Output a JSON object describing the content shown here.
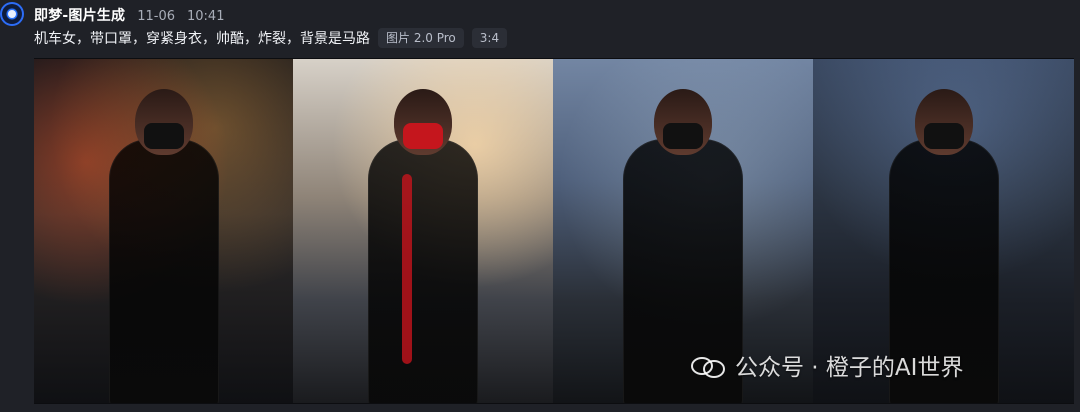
{
  "header": {
    "bot_name": "即梦-图片生成",
    "date": "11-06",
    "time": "10:41",
    "prompt": "机车女，带口罩，穿紧身衣，帅酷，炸裂，背景是马路",
    "chips": [
      "图片 2.0 Pro",
      "3:4"
    ]
  },
  "images": [
    {
      "label": ""
    },
    {
      "label": ""
    },
    {
      "label": ""
    },
    {
      "label": ""
    }
  ],
  "watermark": {
    "text": "公众号 · 橙子的AI世界",
    "icon": "wechat-icon"
  }
}
